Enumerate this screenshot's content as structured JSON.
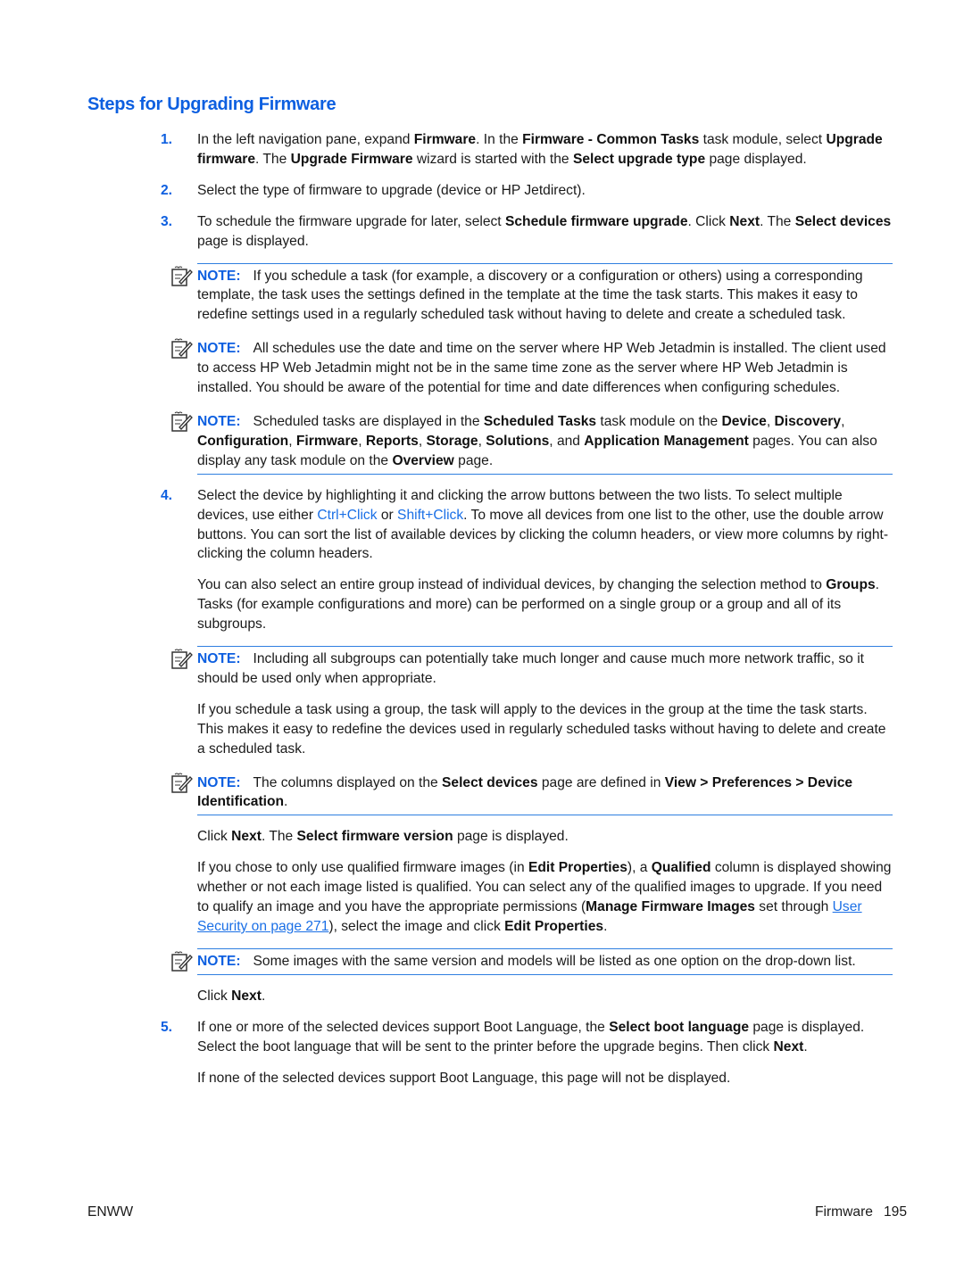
{
  "title": "Steps for Upgrading Firmware",
  "note_label": "NOTE:",
  "steps": [
    {
      "num": "1.",
      "parts": [
        "In the left navigation pane, expand ",
        "Firmware",
        ". In the ",
        "Firmware - Common Tasks",
        " task module, select ",
        "Upgrade firmware",
        ". The ",
        "Upgrade Firmware",
        " wizard is started with the ",
        "Select upgrade type",
        " page displayed."
      ]
    },
    {
      "num": "2.",
      "text": "Select the type of firmware to upgrade (device or HP Jetdirect)."
    },
    {
      "num": "3.",
      "parts": [
        "To schedule the firmware upgrade for later, select ",
        "Schedule firmware upgrade",
        ". Click ",
        "Next",
        ". The ",
        "Select devices",
        " page is displayed."
      ]
    },
    {
      "num": "4.",
      "parts": [
        "Select the device by highlighting it and clicking the arrow buttons between the two lists. To select multiple devices, use either ",
        "Ctrl+Click",
        " or ",
        "Shift+Click",
        ". To move all devices from one list to the other, use the double arrow buttons. You can sort the list of available devices by clicking the column headers, or view more columns by right-clicking the column headers."
      ]
    },
    {
      "num": "5.",
      "parts": [
        "If one or more of the selected devices support Boot Language, the ",
        "Select boot language",
        " page is displayed. Select the boot language that will be sent to the printer before the upgrade begins. Then click ",
        "Next",
        "."
      ]
    }
  ],
  "notes": [
    {
      "text": "If you schedule a task (for example, a discovery or a configuration or others) using a corresponding template, the task uses the settings defined in the template at the time the task starts. This makes it easy to redefine settings used in a regularly scheduled task without having to delete and create a scheduled task."
    },
    {
      "text": "All schedules use the date and time on the server where HP Web Jetadmin is installed. The client used to access HP Web Jetadmin might not be in the same time zone as the server where HP Web Jetadmin is installed. You should be aware of the potential for time and date differences when configuring schedules."
    },
    {
      "parts": [
        "Scheduled tasks are displayed in the ",
        "Scheduled Tasks",
        " task module on the ",
        "Device",
        ", ",
        "Discovery",
        ", ",
        "Configuration",
        ", ",
        "Firmware",
        ", ",
        "Reports",
        ", ",
        "Storage",
        ", ",
        "Solutions",
        ", and ",
        "Application Management",
        " pages. You can also display any task module on the ",
        "Overview",
        " page."
      ]
    },
    {
      "text": "Including all subgroups can potentially take much longer and cause much more network traffic, so it should be used only when appropriate."
    },
    {
      "parts": [
        "The columns displayed on the ",
        "Select devices",
        " page are defined in ",
        "View > Preferences > Device Identification",
        "."
      ]
    },
    {
      "text": "Some images with the same version and models will be listed as one option on the drop-down list."
    }
  ],
  "paras": {
    "groups": [
      "You can also select an entire group instead of individual devices, by changing the selection method to ",
      "Groups",
      ". Tasks (for example configurations and more) can be performed on a single group or a group and all of its subgroups."
    ],
    "schedule_group": "If you schedule a task using a group, the task will apply to the devices in the group at the time the task starts. This makes it easy to redefine the devices used in regularly scheduled tasks without having to delete and create a scheduled task.",
    "click_next_fw": [
      "Click ",
      "Next",
      ". The ",
      "Select firmware version",
      " page is displayed."
    ],
    "qualified": [
      "If you chose to only use qualified firmware images (in ",
      "Edit Properties",
      "), a ",
      "Qualified",
      " column is displayed showing whether or not each image listed is qualified. You can select any of the qualified images to upgrade. If you need to qualify an image and you have the appropriate permissions (",
      "Manage Firmware Images",
      " set through ",
      "User Security on page 271",
      "), select the image and click ",
      "Edit Properties",
      "."
    ],
    "click_next": [
      "Click ",
      "Next",
      "."
    ],
    "no_boot": "If none of the selected devices support Boot Language, this page will not be displayed."
  },
  "footer": {
    "left": "ENWW",
    "section": "Firmware",
    "page": "195"
  },
  "colors": {
    "accent": "#0d5fe0",
    "rule": "#2f7fe0",
    "link": "#1a6fe6"
  }
}
